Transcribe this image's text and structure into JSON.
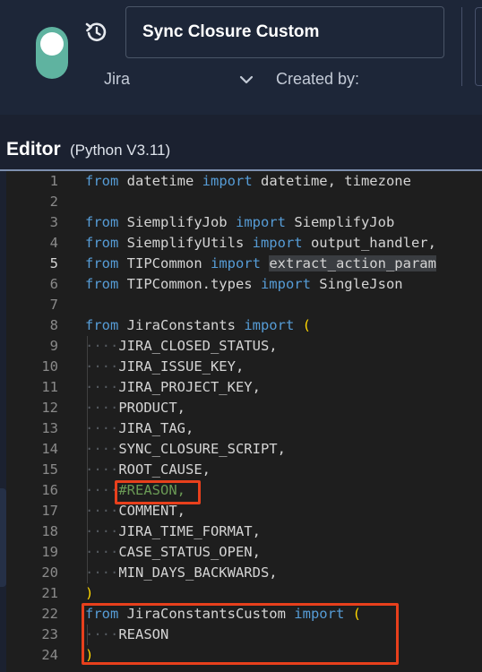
{
  "header": {
    "job_name": "Sync Closure Custom",
    "integration": "Jira",
    "created_by_label": "Created by:",
    "toggle_color": "#5fb3a0",
    "enabled": true,
    "icons": [
      "history-icon",
      "chevron-down-icon"
    ]
  },
  "editor": {
    "title": "Editor",
    "subtitle": "(Python V3.11)",
    "active_line": 5,
    "highlighted_lines": [
      16,
      22,
      23,
      24
    ],
    "highlight_color": "#e8401c"
  },
  "code_lines": [
    {
      "n": "1",
      "text": "from datetime import datetime, timezone"
    },
    {
      "n": "2",
      "text": ""
    },
    {
      "n": "3",
      "text": "from SiemplifyJob import SiemplifyJob"
    },
    {
      "n": "4",
      "text": "from SiemplifyUtils import output_handler,"
    },
    {
      "n": "5",
      "text": "from TIPCommon import extract_action_param"
    },
    {
      "n": "6",
      "text": "from TIPCommon.types import SingleJson"
    },
    {
      "n": "7",
      "text": ""
    },
    {
      "n": "8",
      "text": "from JiraConstants import ("
    },
    {
      "n": "9",
      "text": "    JIRA_CLOSED_STATUS,"
    },
    {
      "n": "10",
      "text": "    JIRA_ISSUE_KEY,"
    },
    {
      "n": "11",
      "text": "    JIRA_PROJECT_KEY,"
    },
    {
      "n": "12",
      "text": "    PRODUCT,"
    },
    {
      "n": "13",
      "text": "    JIRA_TAG,"
    },
    {
      "n": "14",
      "text": "    SYNC_CLOSURE_SCRIPT,"
    },
    {
      "n": "15",
      "text": "    ROOT_CAUSE,"
    },
    {
      "n": "16",
      "text": "    #REASON,"
    },
    {
      "n": "17",
      "text": "    COMMENT,"
    },
    {
      "n": "18",
      "text": "    JIRA_TIME_FORMAT,"
    },
    {
      "n": "19",
      "text": "    CASE_STATUS_OPEN,"
    },
    {
      "n": "20",
      "text": "    MIN_DAYS_BACKWARDS,"
    },
    {
      "n": "21",
      "text": ")"
    },
    {
      "n": "22",
      "text": "from JiraConstantsCustom import ("
    },
    {
      "n": "23",
      "text": "    REASON"
    },
    {
      "n": "24",
      "text": ")"
    }
  ]
}
